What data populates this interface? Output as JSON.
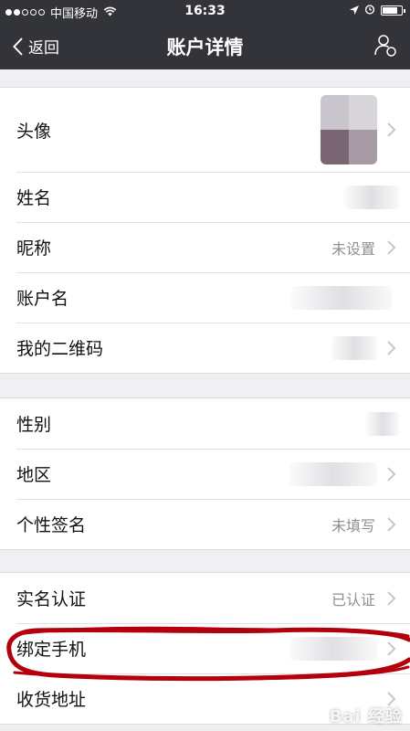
{
  "statusbar": {
    "carrier": "中国移动",
    "time": "16:33",
    "battery_level": 0.8
  },
  "navbar": {
    "back_label": "返回",
    "title": "账户详情"
  },
  "groups": [
    {
      "rows": [
        {
          "label": "头像",
          "value": ""
        },
        {
          "label": "姓名",
          "value": ""
        },
        {
          "label": "昵称",
          "value": "未设置"
        },
        {
          "label": "账户名",
          "value": ""
        },
        {
          "label": "我的二维码",
          "value": ""
        }
      ]
    },
    {
      "rows": [
        {
          "label": "性别",
          "value": ""
        },
        {
          "label": "地区",
          "value": ""
        },
        {
          "label": "个性签名",
          "value": "未填写"
        }
      ]
    },
    {
      "rows": [
        {
          "label": "实名认证",
          "value": "已认证"
        },
        {
          "label": "绑定手机",
          "value": ""
        },
        {
          "label": "收货地址",
          "value": ""
        }
      ]
    }
  ],
  "watermark": "Bai 经验",
  "colors": {
    "navbar_bg": "#33343a",
    "page_bg": "#efeff4",
    "value_text": "#8f8f94",
    "annotation_red": "#b4000c"
  },
  "icons": [
    "back-chevron-icon",
    "user-settings-icon",
    "chevron-right-icon",
    "wifi-icon",
    "location-arrow-icon",
    "alarm-icon",
    "battery-icon"
  ]
}
